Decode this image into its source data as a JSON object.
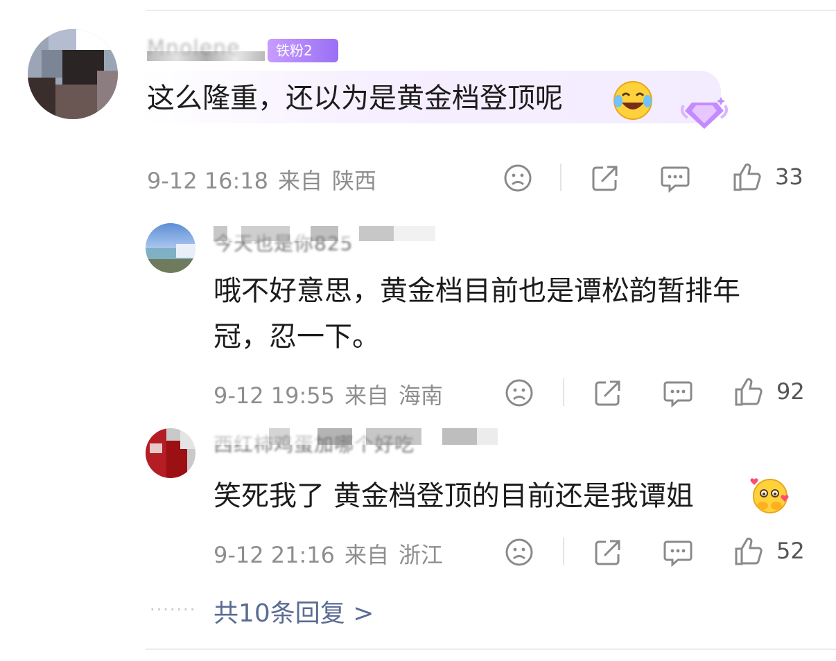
{
  "top_comment": {
    "username": "Mnolene",
    "badge": "铁粉2",
    "text": "这么隆重，还以为是黄金档登顶呢",
    "emoji": "laughing-crying-emoji",
    "time": "9-12 16:18",
    "source_prefix": "来自",
    "location": "陕西",
    "likes": "33"
  },
  "replies": [
    {
      "username": "今天也是你825",
      "text_line1": "哦不好意思，黄金档目前也是谭松韵暂排年",
      "text_line2": "冠，忍一下。",
      "time": "9-12 19:55",
      "source_prefix": "来自",
      "location": "海南",
      "likes": "92"
    },
    {
      "username": "西红柿鸡蛋加哪个好吃",
      "text": "笑死我了 黄金档登顶的目前还是我谭姐",
      "emoji": "heart-hug-emoji",
      "time": "9-12 21:16",
      "source_prefix": "来自",
      "location": "浙江",
      "likes": "52"
    }
  ],
  "more_replies": {
    "dots": "·······",
    "label": "共10条回复 >"
  },
  "colors": {
    "accent_link": "#5a6c93",
    "meta_gray": "#8e8e8e",
    "badge_purple": "#9a6ff5"
  },
  "icons": [
    "dislike-face-icon",
    "share-icon",
    "comment-icon",
    "like-thumb-icon",
    "diamond-vip-icon"
  ]
}
